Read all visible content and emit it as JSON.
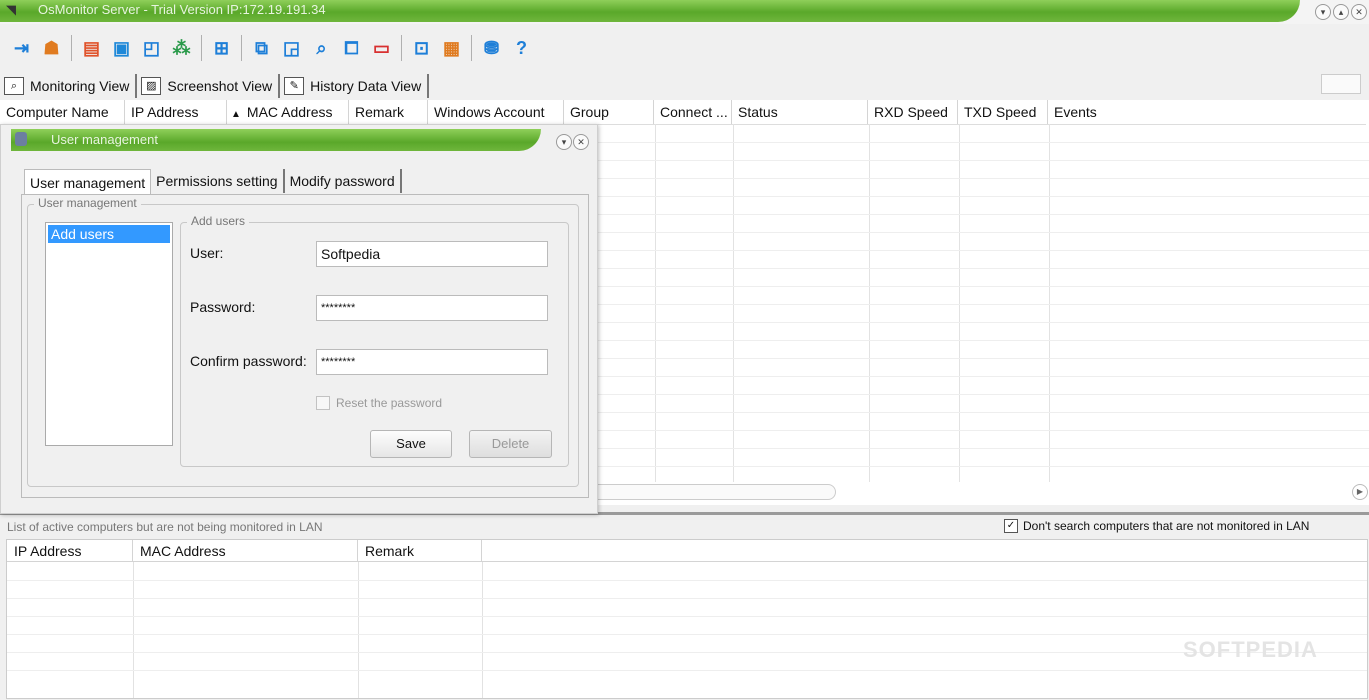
{
  "window": {
    "title": "OsMonitor Server - Trial Version IP:172.19.191.34"
  },
  "toolbar": {
    "icons": [
      "exit-icon",
      "user-icon",
      "windows-icon",
      "display-settings-icon",
      "report-icon",
      "group-users-icon",
      "layout-icon",
      "remote-desktop-icon",
      "broadcast-icon",
      "search-computer-icon",
      "network-icon",
      "screen-icon",
      "ip-config-icon",
      "policy-icon",
      "shop-icon",
      "help-icon"
    ]
  },
  "tabs": [
    {
      "label": "Monitoring View"
    },
    {
      "label": "Screenshot View"
    },
    {
      "label": "History Data View"
    }
  ],
  "main_table": {
    "columns": [
      "Computer Name",
      "IP Address",
      "MAC Address",
      "Remark",
      "Windows Account",
      "Group",
      "Connect ...",
      "Status",
      "RXD Speed",
      "TXD Speed",
      "Events"
    ],
    "sort_indicator": "▲"
  },
  "bottom_panel": {
    "caption": "List of active computers but are not being monitored in LAN",
    "checkbox_label": "Don't search computers that are not monitored in LAN",
    "checkbox_checked": true,
    "columns": [
      "IP Address",
      "MAC Address",
      "Remark"
    ]
  },
  "dialog": {
    "title": "User management",
    "tabs": [
      "User management",
      "Permissions setting",
      "Modify password"
    ],
    "group_label": "User management",
    "list_items": [
      "Add users"
    ],
    "subgroup_label": "Add users",
    "user_label": "User:",
    "user_value": "Softpedia",
    "password_label": "Password:",
    "password_value": "********",
    "confirm_label": "Confirm password:",
    "confirm_value": "********",
    "reset_label": "Reset the password",
    "save_label": "Save",
    "delete_label": "Delete"
  },
  "watermark": "SOFTPEDIA",
  "colors": {
    "title_green": "#5aa82a",
    "selection_blue": "#3399ff"
  }
}
